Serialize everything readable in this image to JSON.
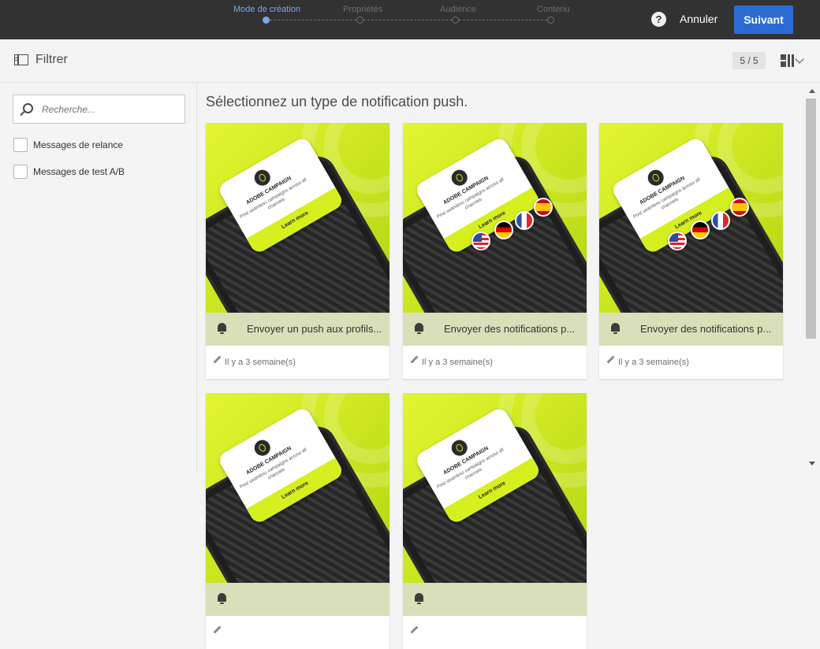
{
  "wizard": {
    "steps": [
      {
        "label": "Mode de création",
        "active": true
      },
      {
        "label": "Propriétés",
        "active": false
      },
      {
        "label": "Audience",
        "active": false
      },
      {
        "label": "Contenu",
        "active": false
      }
    ],
    "help_label": "?",
    "cancel_label": "Annuler",
    "next_label": "Suivant"
  },
  "toolbar": {
    "filter_label": "Filtrer",
    "pager": "5 / 5"
  },
  "sidebar": {
    "search_placeholder": "Recherche...",
    "filters": [
      {
        "label": "Messages de relance",
        "checked": false
      },
      {
        "label": "Messages de test A/B",
        "checked": false
      }
    ]
  },
  "main": {
    "title": "Sélectionnez un type de notification push.",
    "cards": [
      {
        "title": "Envoyer un push aux profils...",
        "time": "Il y a 3 semaine(s)",
        "flags": false
      },
      {
        "title": "Envoyer des notifications p...",
        "time": "Il y a 3 semaine(s)",
        "flags": true
      },
      {
        "title": "Envoyer des notifications p...",
        "time": "Il y a 3 semaine(s)",
        "flags": true
      },
      {
        "title": "",
        "time": "",
        "flags": false
      },
      {
        "title": "",
        "time": "",
        "flags": false
      }
    ],
    "thumbnail": {
      "brand": "ADOBE CAMPAIGN",
      "text": "Post seamless campaigns across all channels",
      "cta": "Learn more"
    }
  },
  "colors": {
    "topbar": "#323232",
    "accent": "#2d6bd4",
    "active_step": "#7ba8e6",
    "thumbnail_green": "#cde821",
    "card_bar": "#d9e0b9"
  }
}
